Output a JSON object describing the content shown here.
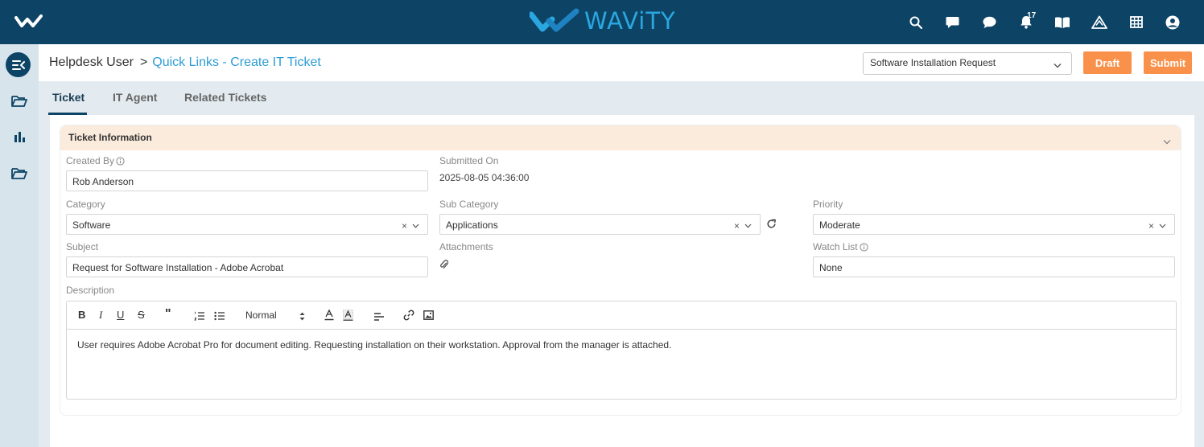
{
  "topbar": {
    "brand_name": "WAViTY",
    "notification_count": "17",
    "icons": [
      "search-icon",
      "chat-icon",
      "comment-icon",
      "bell-icon",
      "book-icon",
      "triangle-icon",
      "grid-icon",
      "user-icon"
    ],
    "colors": {
      "background": "#0d4466",
      "brand": "#2aa7e0"
    }
  },
  "sidebar": {
    "items": [
      "sidebar-toggle-icon",
      "folder-open-icon",
      "bar-chart-icon",
      "folder-open-icon"
    ]
  },
  "breadcrumb": {
    "root": "Helpdesk User",
    "separator": ">",
    "current": "Quick Links - Create IT Ticket"
  },
  "header": {
    "template_value": "Software Installation Request",
    "draft_label": "Draft",
    "submit_label": "Submit",
    "accent_color": "#f9914a"
  },
  "tabs": [
    {
      "label": "Ticket",
      "active": true
    },
    {
      "label": "IT Agent",
      "active": false
    },
    {
      "label": "Related Tickets",
      "active": false
    }
  ],
  "section": {
    "title": "Ticket Information"
  },
  "form": {
    "created_by": {
      "label": "Created By",
      "value": "Rob Anderson"
    },
    "submitted_on": {
      "label": "Submitted On",
      "value": "2025-08-05 04:36:00"
    },
    "category": {
      "label": "Category",
      "value": "Software"
    },
    "sub_category": {
      "label": "Sub Category",
      "value": "Applications"
    },
    "priority": {
      "label": "Priority",
      "value": "Moderate"
    },
    "subject": {
      "label": "Subject",
      "value": "Request for Software Installation - Adobe Acrobat"
    },
    "attachments": {
      "label": "Attachments"
    },
    "watch_list": {
      "label": "Watch List",
      "value": "None"
    },
    "description": {
      "label": "Description",
      "heading_select": "Normal",
      "text": "User requires Adobe Acrobat Pro for document editing. Requesting installation on their workstation. Approval from the manager is attached."
    }
  }
}
